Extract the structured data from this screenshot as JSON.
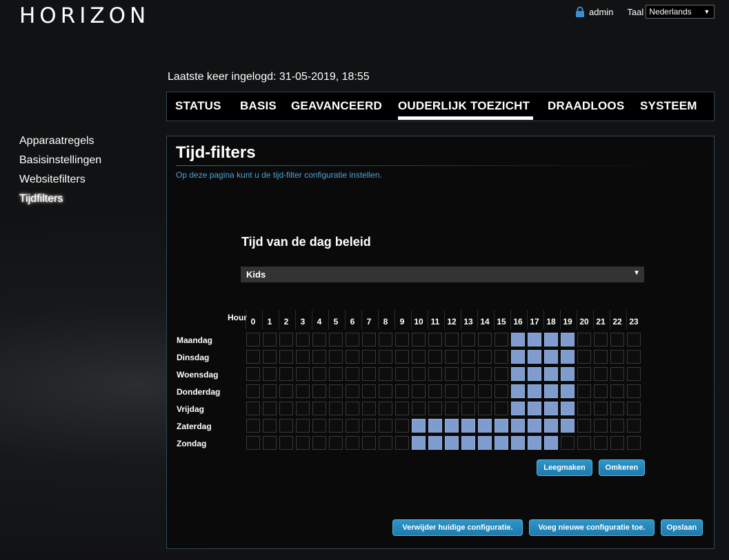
{
  "brand": {
    "logo": "HORIZON"
  },
  "topbar": {
    "user": "admin",
    "lang_label": "Taal",
    "lang_value": "Nederlands",
    "lang_arrow": "▼"
  },
  "last_login": "Laatste keer ingelogd: 31-05-2019, 18:55",
  "nav": [
    {
      "label": "STATUS",
      "active": false
    },
    {
      "label": "BASIS",
      "active": false
    },
    {
      "label": "GEAVANCEERD",
      "active": false
    },
    {
      "label": "OUDERLIJK TOEZICHT",
      "active": true
    },
    {
      "label": "DRAADLOOS",
      "active": false
    },
    {
      "label": "SYSTEEM",
      "active": false
    }
  ],
  "sidebar": [
    {
      "label": "Apparaatregels",
      "active": false
    },
    {
      "label": "Basisinstellingen",
      "active": false
    },
    {
      "label": "Websitefilters",
      "active": false
    },
    {
      "label": "Tijdfilters",
      "active": true
    }
  ],
  "panel": {
    "title": "Tijd-filters",
    "description": "Op deze pagina kunt u de tijd-filter configuratie instellen.",
    "policy_heading": "Tijd van de dag beleid",
    "policy_value": "Kids",
    "policy_arrow": "▼"
  },
  "grid": {
    "hour_label": "Hour",
    "hours": [
      "0",
      "1",
      "2",
      "3",
      "4",
      "5",
      "6",
      "7",
      "8",
      "9",
      "10",
      "11",
      "12",
      "13",
      "14",
      "15",
      "16",
      "17",
      "18",
      "19",
      "20",
      "21",
      "22",
      "23"
    ],
    "days": [
      {
        "name": "Maandag",
        "active_hours": [
          16,
          17,
          18,
          19
        ]
      },
      {
        "name": "Dinsdag",
        "active_hours": [
          16,
          17,
          18,
          19
        ]
      },
      {
        "name": "Woensdag",
        "active_hours": [
          16,
          17,
          18,
          19
        ]
      },
      {
        "name": "Donderdag",
        "active_hours": [
          16,
          17,
          18,
          19
        ]
      },
      {
        "name": "Vrijdag",
        "active_hours": [
          16,
          17,
          18,
          19
        ]
      },
      {
        "name": "Zaterdag",
        "active_hours": [
          10,
          11,
          12,
          13,
          14,
          15,
          16,
          17,
          18,
          19
        ]
      },
      {
        "name": "Zondag",
        "active_hours": [
          10,
          11,
          12,
          13,
          14,
          15,
          16,
          17,
          18
        ]
      }
    ]
  },
  "buttons": {
    "clear": "Leegmaken",
    "invert": "Omkeren",
    "delete_config": "Verwijder huidige configuratie.",
    "add_config": "Voeg nieuwe configuratie toe.",
    "save": "Opslaan"
  },
  "colors": {
    "active_cell": "#7f9ccf",
    "accent": "#4aa3d8",
    "button": "#1e7bad"
  }
}
